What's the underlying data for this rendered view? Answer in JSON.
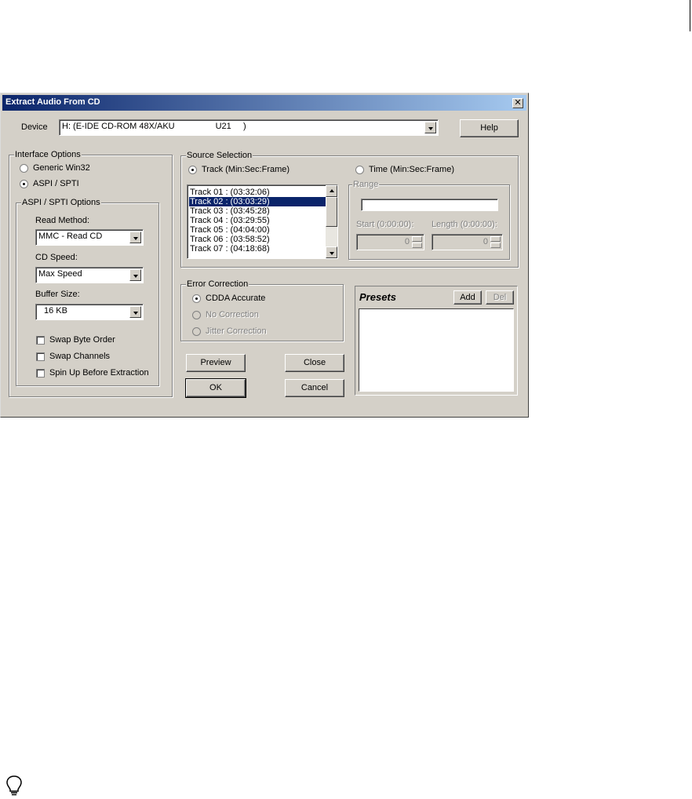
{
  "dialog": {
    "title": "Extract Audio From CD",
    "close_glyph": "✕"
  },
  "device": {
    "label": "Device",
    "value": "H: (E-IDE CD-ROM 48X/AKU                 U21     )",
    "help_label": "Help"
  },
  "interface_options": {
    "legend": "Interface Options",
    "generic_win32": "Generic Win32",
    "aspi_spti": "ASPI / SPTI",
    "selected": "ASPI / SPTI"
  },
  "aspi_options": {
    "legend": "ASPI / SPTI Options",
    "read_method_label": "Read Method:",
    "read_method_value": "MMC - Read CD",
    "cd_speed_label": "CD Speed:",
    "cd_speed_value": "Max Speed",
    "buffer_size_label": "Buffer Size:",
    "buffer_size_value": "16 KB",
    "swap_byte_order": "Swap Byte Order",
    "swap_channels": "Swap Channels",
    "spin_up": "Spin Up Before Extraction"
  },
  "source_selection": {
    "legend": "Source Selection",
    "track_label": "Track (Min:Sec:Frame)",
    "time_label": "Time (Min:Sec:Frame)",
    "selected_mode": "Track (Min:Sec:Frame)",
    "tracks": [
      "Track 01 : (03:32:06)",
      "Track 02 : (03:03:29)",
      "Track 03 : (03:45:28)",
      "Track 04 : (03:29:55)",
      "Track 05 : (04:04:00)",
      "Track 06 : (03:58:52)",
      "Track 07 : (04:18:68)"
    ],
    "selected_track": "Track 02 : (03:03:29)",
    "range_legend": "Range",
    "start_label": "Start (0:00:00):",
    "start_value": "0",
    "length_label": "Length (0:00:00):",
    "length_value": "0"
  },
  "error_correction": {
    "legend": "Error Correction",
    "cdda_accurate": "CDDA Accurate",
    "no_correction": "No Correction",
    "jitter_correction": "Jitter Correction",
    "selected": "CDDA Accurate"
  },
  "buttons": {
    "preview": "Preview",
    "close": "Close",
    "ok": "OK",
    "cancel": "Cancel"
  },
  "presets": {
    "title": "Presets",
    "add": "Add",
    "del": "Del"
  },
  "icons": {
    "tip": "lightbulb-icon"
  }
}
